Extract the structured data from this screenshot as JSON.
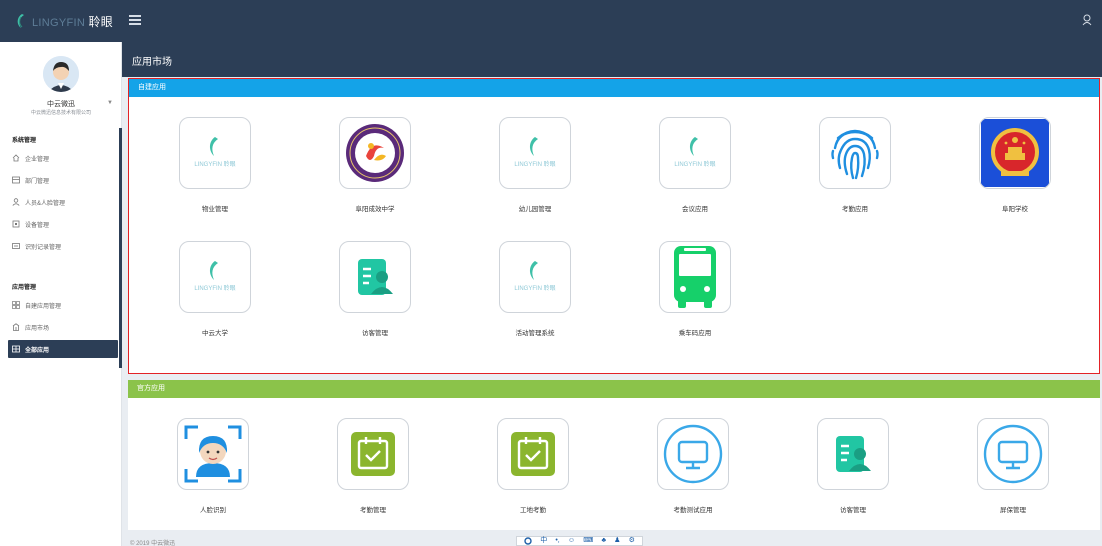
{
  "colors": {
    "topbar": "#2c3e56",
    "own_header": "#14a3e8",
    "official_header": "#8bc34a",
    "highlight": "#e32226"
  },
  "brand": {
    "latin": "LINGYFIN",
    "cjk": "聆眼",
    "icon": "teal-leaf-logo-icon"
  },
  "user": {
    "name": "中云微迅",
    "company": "中云微迅信息技术有限公司"
  },
  "sidebar": {
    "sections": [
      {
        "label": "系统管理",
        "items": [
          {
            "label": "企业管理",
            "icon": "home-icon"
          },
          {
            "label": "部门管理",
            "icon": "department-icon"
          },
          {
            "label": "人员&人脸管理",
            "icon": "person-icon"
          },
          {
            "label": "设备管理",
            "icon": "device-icon"
          },
          {
            "label": "识别记录管理",
            "icon": "records-icon"
          }
        ]
      },
      {
        "label": "应用管理",
        "items": [
          {
            "label": "自建应用管理",
            "icon": "grid-icon"
          },
          {
            "label": "应用市场",
            "icon": "store-icon"
          },
          {
            "label": "全部应用",
            "icon": "apps-icon"
          }
        ]
      }
    ],
    "active_item": "全部应用"
  },
  "page": {
    "title": "应用市场"
  },
  "own_apps": {
    "header": "自建应用",
    "apps": [
      {
        "label": "物业管理",
        "icon": "lingyfin-logo-icon"
      },
      {
        "label": "阜阳成效中学",
        "icon": "school-emblem-icon"
      },
      {
        "label": "幼儿园管理",
        "icon": "lingyfin-logo-icon"
      },
      {
        "label": "会议应用",
        "icon": "lingyfin-logo-icon"
      },
      {
        "label": "考勤应用",
        "icon": "fingerprint-icon"
      },
      {
        "label": "阜阳学校",
        "icon": "national-emblem-icon"
      },
      {
        "label": "中云大学",
        "icon": "lingyfin-logo-icon"
      },
      {
        "label": "访客管理",
        "icon": "visitor-badge-icon"
      },
      {
        "label": "活动管理系统",
        "icon": "lingyfin-logo-icon"
      },
      {
        "label": "乘车码应用",
        "icon": "bus-icon"
      }
    ]
  },
  "official_apps": {
    "header": "官方应用",
    "apps": [
      {
        "label": "人脸识别",
        "icon": "face-recognition-icon"
      },
      {
        "label": "考勤管理",
        "icon": "calendar-check-icon"
      },
      {
        "label": "工地考勤",
        "icon": "calendar-check-icon"
      },
      {
        "label": "考勤测试应用",
        "icon": "monitor-icon"
      },
      {
        "label": "访客管理",
        "icon": "visitor-badge-icon"
      },
      {
        "label": "屏保管理",
        "icon": "monitor-icon"
      }
    ]
  },
  "footer": {
    "copyright": "© 2019 中云微迅"
  },
  "ime_toolbar": {
    "glyphs": [
      "中",
      "•,",
      "☺",
      "⌨",
      "♣",
      "♟",
      "⚙"
    ]
  }
}
